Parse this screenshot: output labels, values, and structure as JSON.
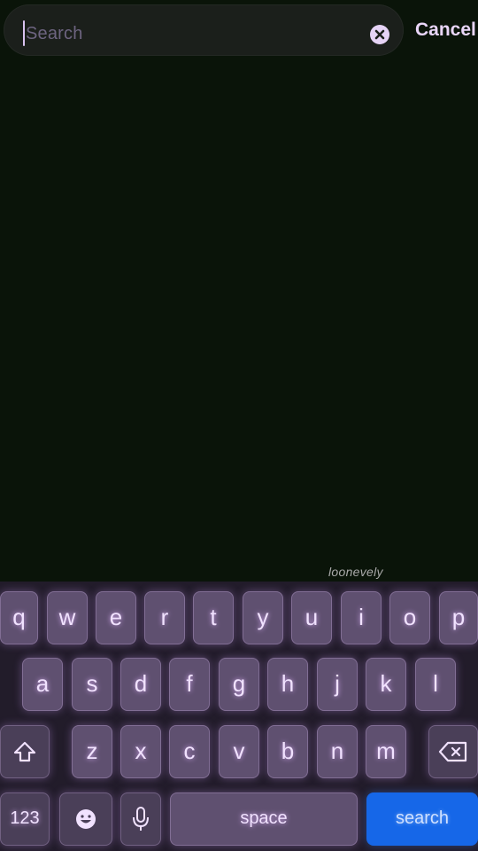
{
  "search": {
    "placeholder": "Search",
    "cancel_label": "Cancel"
  },
  "watermark": "loonevely",
  "keyboard": {
    "row1": [
      "q",
      "w",
      "e",
      "r",
      "t",
      "y",
      "u",
      "i",
      "o",
      "p"
    ],
    "row2": [
      "a",
      "s",
      "d",
      "f",
      "g",
      "h",
      "j",
      "k",
      "l"
    ],
    "row3": [
      "z",
      "x",
      "c",
      "v",
      "b",
      "n",
      "m"
    ],
    "numbers_label": "123",
    "space_label": "space",
    "search_label": "search"
  },
  "colors": {
    "background": "#0a1409",
    "key": "#5f5070",
    "search_key": "#1667e8",
    "accent_text": "#e9d6f8"
  }
}
